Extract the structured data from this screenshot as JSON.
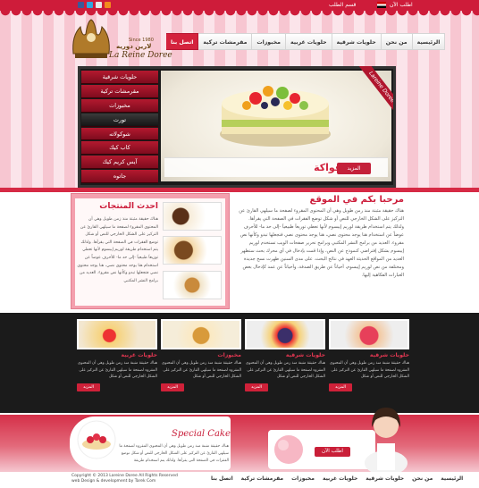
{
  "topbar": {
    "login": "اطلب الآن",
    "cart": "قسم الطلب"
  },
  "logo": {
    "since": "Since 1980",
    "arabic": "لارين دوريه",
    "latin": "La Reine Doree"
  },
  "nav": {
    "items": [
      "الرئيسية",
      "من نحن",
      "حلويات شرقية",
      "حلويات غربية",
      "مخبوزات",
      "مقرمشات تركية",
      "اتصل بنا"
    ],
    "active_index": 6
  },
  "slider": {
    "menu": [
      "حلويات شرقية",
      "مقرمشات تركية",
      "مخبوزات",
      "تورت",
      "شوكولاته",
      "كاب كيك",
      "آيس كريم كيك",
      "جاتوه"
    ],
    "active_index": 3,
    "ribbon": "Lareine Doree",
    "caption": "تورته فواكة",
    "more": "المزيد"
  },
  "welcome": {
    "title": "مرحبا بكم في الموقع",
    "text": "هناك حقيقة مثبتة منذ زمن طويل وهي أن المحتوى المقروء لصفحة ما سيلهي القارئ عن التركيز على الشكل الخارجي للنص أو شكل توضع الفقرات في الصفحة التي يقرأها. ولذلك يتم استخدام طريقة لوريم إيبسوم لأنها تعطي توزيعاَ طبيعياَ -إلى حد ما- للأحرف عوضاً عن استخدام هنا يوجد محتوى نصي، هنا يوجد محتوى نصي فتجعلها تبدو وكأنها نص مقروء. العديد من برامح النشر المكتبي وبرامح تحرير صفحات الويب تستخدم لوريم إيبسوم بشكل إفتراضي كنموذج عن النص، وإذا قمت بإدخال في أي محرك بحث ستظهر العديد من المواقع الحديثة العهد في نتائج البحث. على مدى السنين ظهرت نسخ جديدة ومختلفة من نص لوريم إيبسوم، أحياناً عن طريق الصدفة، وأحياناً عن عمد كإدخال بعض العبارات الفكاهية إليها."
  },
  "products": {
    "title": "احدث المنتجات",
    "text": "هناك حقيقة مثبتة منذ زمن طويل وهي أن المحتوى المقروء لصفحة ما سيلهي القارئ عن التركيز على الشكل الخارجي للنص أو شكل توضع الفقرات في الصفحة التي يقرأها. ولذلك يتم استخدام طريقة لوريم إيبسوم لأنها تعطي توزيعاَ طبيعياَ -إلى حد ما- للأحرف عوضاً عن استخدام هنا يوجد محتوى نصي، هنا يوجد محتوى نصي فتجعلها تبدو وكأنها نص مقروء. العديد من برامح النشر المكتبي"
  },
  "categories": [
    {
      "title": "حلويات شرقية",
      "text": "هناك حقيقة مثبتة منذ زمن طويل وهي أن المحتوى المقروء لصفحة ما سيلهي القارئ عن التركيز على الشكل الخارجي للنص أو شكل",
      "button": "المزيد"
    },
    {
      "title": "حلويات غربية",
      "text": "هناك حقيقة مثبتة منذ زمن طويل وهي أن المحتوى المقروء لصفحة ما سيلهي القارئ عن التركيز على الشكل الخارجي للنص أو شكل",
      "button": "المزيد"
    },
    {
      "title": "مخبوزات",
      "text": "هناك حقيقة مثبتة منذ زمن طويل وهي أن المحتوى المقروء لصفحة ما سيلهي القارئ عن التركيز على الشكل الخارجي للنص أو شكل",
      "button": "المزيد"
    },
    {
      "title": "حلويات شرقية",
      "text": "هناك حقيقة مثبتة منذ زمن طويل وهي أن المحتوى المقروء لصفحة ما سيلهي القارئ عن التركيز على الشكل الخارجي للنص أو شكل",
      "button": "المزيد"
    }
  ],
  "special": {
    "title": "Special Cake",
    "text": "هناك حقيقة مثبتة منذ زمن طويل وهي أن المحتوى المقروء لصفحة ما سيلهي القارئ عن التركيز على الشكل الخارجي للنص أو شكل توضع الفقرات في الصفحة التي يقرأها. ولذلك يتم استخدام طريقة"
  },
  "contact": {
    "button": "اطلب الآن"
  },
  "footer": {
    "copyright": "Copyright © 2013 Lareine Doree All Rights Reserved",
    "credit": "web Design & development by Tarek Com",
    "nav": [
      "الرئيسية",
      "من نحن",
      "حلويات شرقية",
      "حلويات غربية",
      "مخبوزات",
      "مقرمشات تركية",
      "اتصل بنا"
    ]
  },
  "colors": {
    "brand_red": "#ce1c3a",
    "pink_stripe": "#f7c6d1",
    "dark_band": "#1b1b1b"
  },
  "icons": [
    "facebook-icon",
    "twitter-icon",
    "youtube-icon",
    "rss-icon",
    "flag-icon"
  ]
}
